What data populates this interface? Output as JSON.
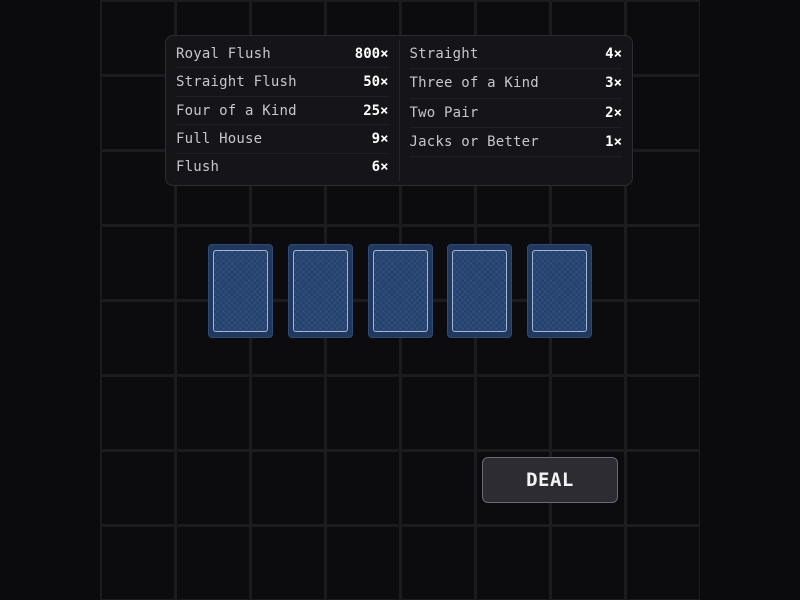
{
  "paytable": {
    "left": [
      {
        "hand": "Royal Flush",
        "payout": "800×"
      },
      {
        "hand": "Straight Flush",
        "payout": "50×"
      },
      {
        "hand": "Four of a Kind",
        "payout": "25×"
      },
      {
        "hand": "Full House",
        "payout": "9×"
      },
      {
        "hand": "Flush",
        "payout": "6×"
      }
    ],
    "right": [
      {
        "hand": "Straight",
        "payout": "4×"
      },
      {
        "hand": "Three of a Kind",
        "payout": "3×"
      },
      {
        "hand": "Two Pair",
        "payout": "2×"
      },
      {
        "hand": "Jacks or Better",
        "payout": "1×"
      }
    ]
  },
  "hand": {
    "cards": [
      {
        "state": "face-down"
      },
      {
        "state": "face-down"
      },
      {
        "state": "face-down"
      },
      {
        "state": "face-down"
      },
      {
        "state": "face-down"
      }
    ]
  },
  "controls": {
    "deal_label": "DEAL"
  },
  "colors": {
    "background": "#0b0b0d",
    "card_back": "#24426f",
    "button": "#2c2c32"
  }
}
